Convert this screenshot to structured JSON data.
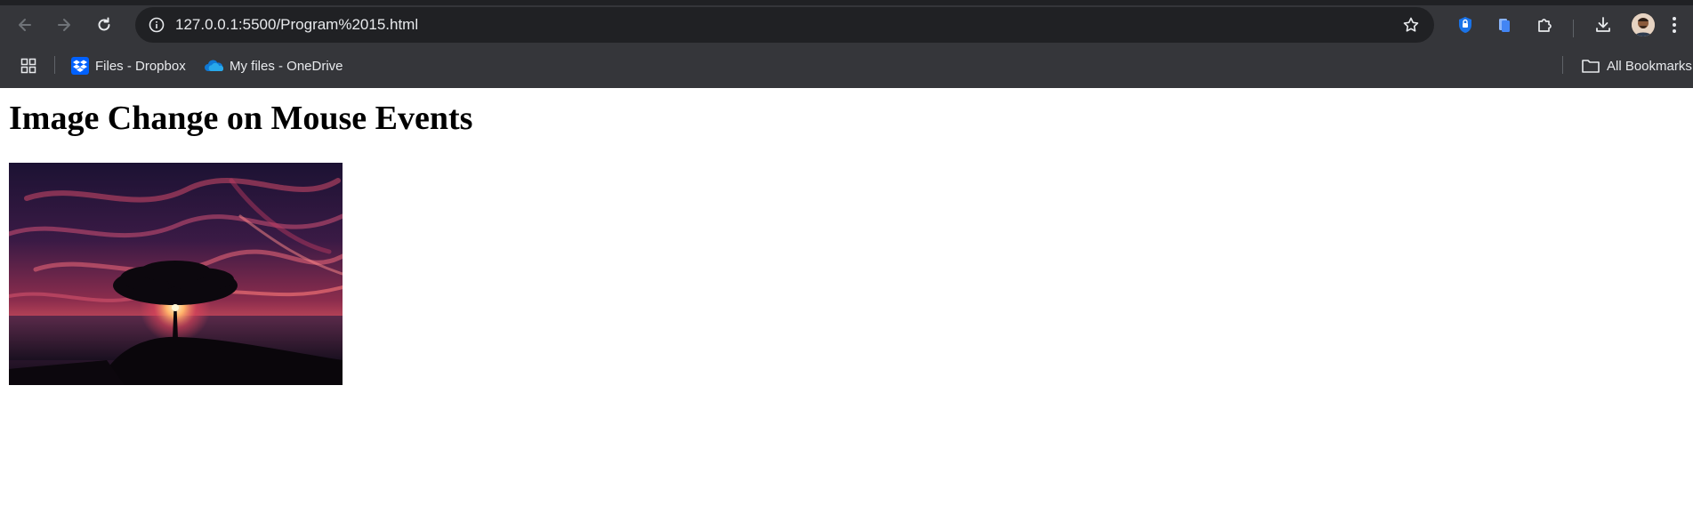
{
  "browser": {
    "url": "127.0.0.1:5500/Program%2015.html",
    "bookmarks": [
      {
        "label": "Files - Dropbox",
        "icon": "dropbox-icon"
      },
      {
        "label": "My files - OneDrive",
        "icon": "onedrive-icon"
      }
    ],
    "all_bookmarks_label": "All Bookmarks"
  },
  "page": {
    "title": "Image Change on Mouse Events",
    "image": {
      "description": "tree-silhouette-sunset-photo"
    }
  },
  "colors": {
    "chrome_bg": "#35363a",
    "omnibox_bg": "#202124",
    "chrome_text": "#e8eaed",
    "dropbox_blue": "#0061fe",
    "onedrive_blue": "#0f78d4"
  }
}
